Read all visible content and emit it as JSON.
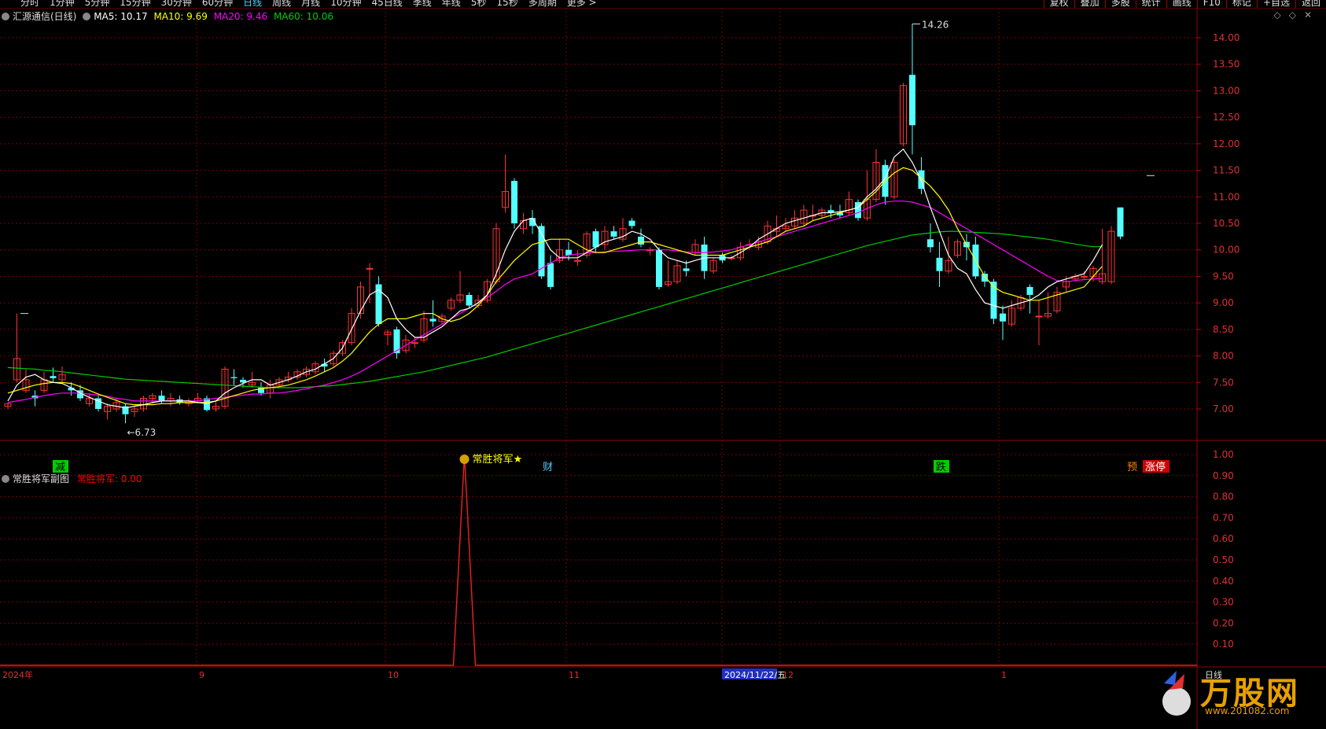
{
  "toolbar": {
    "periods": [
      "分时",
      "1分钟",
      "5分钟",
      "15分钟",
      "30分钟",
      "60分钟",
      "日线",
      "周线",
      "月线",
      "10分钟",
      "45日线",
      "季线",
      "年线",
      "5秒",
      "15秒",
      "多周期",
      "更多 >"
    ],
    "active_period": "日线",
    "tools": [
      "复权",
      "叠加",
      "多股",
      "统计",
      "画线",
      "F10",
      "标记",
      "+自选",
      "返回"
    ]
  },
  "main_legend": {
    "title": "汇源通信(日线)",
    "ma5": "MA5: 10.17",
    "ma10": "MA10: 9.69",
    "ma20": "MA20: 9.46",
    "ma60": "MA60: 10.06",
    "colors": {
      "ma5": "#ffffff",
      "ma10": "#ffff00",
      "ma20": "#ff00ff",
      "ma60": "#00cc00"
    }
  },
  "sub_legend": {
    "title": "常胜将军副图",
    "value": "常胜将军: 0.00",
    "signal_label": "常胜将军★"
  },
  "chart_data": {
    "type": "candlestick",
    "price_axis": [
      "14.00",
      "13.50",
      "13.00",
      "12.50",
      "12.00",
      "11.50",
      "11.00",
      "10.50",
      "10.00",
      "9.50",
      "9.00",
      "8.50",
      "8.00",
      "7.50",
      "7.00"
    ],
    "sub_axis": [
      "1.00",
      "0.90",
      "0.80",
      "0.70",
      "0.60",
      "0.50",
      "0.40",
      "0.30",
      "0.20",
      "0.10"
    ],
    "x_labels": [
      "2024年",
      "9",
      "10",
      "11",
      "2024/11/22/五",
      "12",
      "1"
    ],
    "high_label": "14.26",
    "low_label": "6.73",
    "event_markers": [
      "减",
      "财",
      "跌",
      "预",
      "涨停"
    ],
    "period_label": "日线",
    "candles": [
      [
        7.05,
        7.1,
        7.0,
        7.12
      ],
      [
        7.55,
        7.95,
        7.5,
        8.8
      ],
      [
        7.35,
        7.55,
        7.3,
        7.75
      ],
      [
        7.25,
        7.2,
        7.05,
        7.35
      ],
      [
        7.35,
        7.55,
        7.3,
        7.7
      ],
      [
        7.62,
        7.58,
        7.5,
        7.78
      ],
      [
        7.55,
        7.65,
        7.5,
        7.8
      ],
      [
        7.4,
        7.35,
        7.25,
        7.5
      ],
      [
        7.35,
        7.2,
        7.15,
        7.45
      ],
      [
        7.1,
        7.2,
        7.05,
        7.3
      ],
      [
        7.2,
        7.0,
        6.95,
        7.25
      ],
      [
        6.95,
        7.05,
        6.8,
        7.1
      ],
      [
        7.0,
        7.12,
        6.95,
        7.2
      ],
      [
        7.05,
        6.9,
        6.73,
        7.1
      ],
      [
        6.95,
        7.0,
        6.85,
        7.05
      ],
      [
        7.0,
        7.2,
        6.95,
        7.25
      ],
      [
        7.2,
        7.25,
        7.1,
        7.3
      ],
      [
        7.25,
        7.15,
        7.1,
        7.35
      ],
      [
        7.15,
        7.2,
        7.05,
        7.3
      ],
      [
        7.18,
        7.12,
        7.08,
        7.25
      ],
      [
        7.1,
        7.15,
        7.05,
        7.2
      ],
      [
        7.15,
        7.2,
        7.1,
        7.3
      ],
      [
        7.2,
        6.98,
        6.95,
        7.25
      ],
      [
        7.0,
        7.05,
        6.95,
        7.15
      ],
      [
        7.05,
        7.75,
        7.0,
        7.8
      ],
      [
        7.6,
        7.58,
        7.45,
        7.75
      ],
      [
        7.55,
        7.5,
        7.4,
        7.6
      ],
      [
        7.45,
        7.5,
        7.4,
        7.7
      ],
      [
        7.4,
        7.3,
        7.25,
        7.5
      ],
      [
        7.3,
        7.45,
        7.2,
        7.55
      ],
      [
        7.45,
        7.55,
        7.4,
        7.6
      ],
      [
        7.55,
        7.6,
        7.5,
        7.7
      ],
      [
        7.6,
        7.7,
        7.55,
        7.75
      ],
      [
        7.65,
        7.75,
        7.6,
        7.8
      ],
      [
        7.7,
        7.85,
        7.65,
        7.9
      ],
      [
        7.85,
        7.8,
        7.7,
        7.95
      ],
      [
        7.85,
        8.05,
        7.8,
        8.1
      ],
      [
        8.05,
        8.25,
        8.0,
        8.3
      ],
      [
        8.25,
        8.8,
        8.2,
        8.9
      ],
      [
        8.8,
        9.3,
        8.7,
        9.4
      ],
      [
        9.65,
        9.65,
        9.0,
        9.75
      ],
      [
        9.35,
        8.6,
        8.55,
        9.5
      ],
      [
        8.4,
        8.45,
        8.2,
        8.5
      ],
      [
        8.5,
        8.05,
        7.95,
        8.55
      ],
      [
        8.1,
        8.3,
        8.05,
        8.4
      ],
      [
        8.25,
        8.25,
        8.15,
        8.35
      ],
      [
        8.3,
        8.7,
        8.25,
        8.85
      ],
      [
        8.7,
        8.65,
        8.55,
        9.05
      ],
      [
        8.65,
        8.75,
        8.6,
        8.8
      ],
      [
        8.9,
        9.05,
        8.85,
        9.1
      ],
      [
        9.05,
        9.15,
        9.0,
        9.6
      ],
      [
        9.15,
        8.95,
        8.9,
        9.2
      ],
      [
        8.95,
        9.05,
        8.9,
        9.15
      ],
      [
        9.05,
        9.4,
        9.0,
        9.45
      ],
      [
        9.4,
        10.4,
        9.35,
        10.5
      ],
      [
        10.8,
        11.1,
        10.7,
        11.8
      ],
      [
        11.3,
        10.5,
        10.4,
        11.35
      ],
      [
        10.4,
        10.55,
        10.3,
        10.7
      ],
      [
        10.6,
        10.45,
        10.3,
        10.75
      ],
      [
        10.45,
        9.5,
        9.45,
        10.5
      ],
      [
        9.75,
        9.3,
        9.25,
        9.9
      ],
      [
        9.8,
        10.0,
        9.75,
        10.2
      ],
      [
        10.0,
        9.9,
        9.8,
        10.15
      ],
      [
        9.8,
        9.8,
        9.7,
        10.0
      ],
      [
        9.9,
        10.3,
        9.85,
        10.35
      ],
      [
        10.35,
        10.05,
        9.95,
        10.4
      ],
      [
        10.1,
        10.35,
        10.0,
        10.45
      ],
      [
        10.35,
        10.25,
        10.2,
        10.45
      ],
      [
        10.2,
        10.4,
        10.15,
        10.6
      ],
      [
        10.55,
        10.45,
        10.4,
        10.6
      ],
      [
        10.25,
        10.1,
        10.05,
        10.4
      ],
      [
        10.0,
        10.0,
        9.9,
        10.05
      ],
      [
        10.0,
        9.3,
        9.25,
        10.05
      ],
      [
        9.35,
        9.4,
        9.3,
        9.8
      ],
      [
        9.4,
        9.7,
        9.35,
        9.8
      ],
      [
        9.65,
        9.6,
        9.5,
        9.8
      ],
      [
        9.95,
        10.1,
        9.9,
        10.2
      ],
      [
        10.1,
        9.6,
        9.45,
        10.25
      ],
      [
        9.6,
        9.8,
        9.55,
        9.85
      ],
      [
        9.9,
        9.8,
        9.75,
        9.95
      ],
      [
        9.85,
        9.85,
        9.8,
        9.9
      ],
      [
        9.85,
        10.05,
        9.8,
        10.15
      ],
      [
        10.1,
        10.1,
        10.0,
        10.2
      ],
      [
        10.05,
        10.15,
        10.0,
        10.25
      ],
      [
        10.15,
        10.45,
        10.1,
        10.55
      ],
      [
        10.35,
        10.4,
        10.25,
        10.65
      ],
      [
        10.4,
        10.45,
        10.35,
        10.6
      ],
      [
        10.45,
        10.6,
        10.4,
        10.75
      ],
      [
        10.5,
        10.75,
        10.45,
        10.85
      ],
      [
        10.65,
        10.65,
        10.55,
        10.85
      ],
      [
        10.65,
        10.75,
        10.6,
        10.8
      ],
      [
        10.75,
        10.7,
        10.6,
        10.85
      ],
      [
        10.7,
        10.65,
        10.6,
        10.85
      ],
      [
        10.7,
        10.95,
        10.65,
        11.1
      ],
      [
        10.9,
        10.6,
        10.55,
        10.95
      ],
      [
        10.6,
        10.95,
        10.55,
        11.5
      ],
      [
        10.95,
        11.65,
        10.9,
        11.9
      ],
      [
        11.6,
        11.0,
        10.85,
        11.7
      ],
      [
        11.0,
        11.65,
        10.95,
        11.7
      ],
      [
        12.0,
        13.1,
        11.95,
        13.15
      ],
      [
        13.3,
        12.35,
        11.8,
        14.26
      ],
      [
        11.5,
        11.15,
        11.05,
        11.75
      ],
      [
        10.2,
        10.05,
        9.95,
        10.5
      ],
      [
        9.85,
        9.6,
        9.3,
        10.15
      ],
      [
        9.6,
        9.8,
        9.55,
        10.25
      ],
      [
        9.9,
        10.15,
        9.85,
        10.2
      ],
      [
        10.15,
        10.05,
        9.8,
        10.3
      ],
      [
        10.1,
        9.5,
        9.45,
        10.25
      ],
      [
        9.55,
        9.4,
        9.3,
        9.6
      ],
      [
        9.4,
        8.7,
        8.6,
        9.45
      ],
      [
        8.8,
        8.65,
        8.3,
        8.95
      ],
      [
        8.6,
        8.9,
        8.55,
        9.05
      ],
      [
        8.9,
        9.1,
        8.85,
        9.15
      ],
      [
        9.3,
        9.15,
        8.8,
        9.35
      ],
      [
        8.75,
        8.75,
        8.2,
        9.05
      ],
      [
        8.75,
        8.8,
        8.7,
        9.2
      ],
      [
        8.85,
        9.2,
        8.8,
        9.3
      ],
      [
        9.3,
        9.4,
        9.2,
        9.5
      ],
      [
        9.45,
        9.5,
        9.4,
        9.55
      ],
      [
        9.5,
        9.5,
        9.45,
        9.6
      ],
      [
        9.5,
        9.65,
        9.4,
        9.7
      ],
      [
        9.4,
        9.55,
        9.35,
        10.4
      ],
      [
        9.4,
        10.35,
        9.35,
        10.45
      ],
      [
        10.8,
        10.25,
        10.2,
        10.8
      ]
    ],
    "ma5": [
      7.15,
      7.45,
      7.6,
      7.65,
      7.55,
      7.5,
      7.48,
      7.4,
      7.3,
      7.22,
      7.15,
      7.08,
      7.05,
      7.02,
      7.05,
      7.08,
      7.12,
      7.15,
      7.15,
      7.15,
      7.15,
      7.12,
      7.1,
      7.15,
      7.3,
      7.4,
      7.48,
      7.55,
      7.55,
      7.45,
      7.5,
      7.55,
      7.62,
      7.7,
      7.75,
      7.85,
      7.95,
      8.15,
      8.5,
      8.85,
      9.15,
      9.25,
      9.1,
      8.7,
      8.5,
      8.35,
      8.35,
      8.45,
      8.55,
      8.7,
      8.85,
      8.9,
      9.0,
      9.15,
      9.55,
      10.0,
      10.35,
      10.55,
      10.6,
      10.3,
      10.0,
      9.85,
      9.85,
      9.85,
      9.95,
      10.05,
      10.15,
      10.2,
      10.25,
      10.35,
      10.3,
      10.2,
      10.0,
      9.85,
      9.8,
      9.75,
      9.8,
      9.85,
      9.85,
      9.85,
      9.85,
      9.95,
      10.05,
      10.2,
      10.3,
      10.4,
      10.5,
      10.55,
      10.6,
      10.65,
      10.7,
      10.7,
      10.72,
      10.75,
      10.8,
      11.0,
      11.15,
      11.35,
      11.75,
      11.9,
      11.65,
      11.3,
      10.8,
      10.35,
      9.9,
      9.65,
      9.55,
      9.25,
      9.0,
      8.95,
      8.9,
      8.95,
      9.0,
      9.05,
      9.15,
      9.3,
      9.4,
      9.45,
      9.5,
      9.55,
      9.8,
      10.1
    ],
    "ma10": [
      7.3,
      7.35,
      7.4,
      7.45,
      7.48,
      7.5,
      7.5,
      7.48,
      7.42,
      7.35,
      7.28,
      7.22,
      7.16,
      7.1,
      7.08,
      7.08,
      7.08,
      7.1,
      7.1,
      7.12,
      7.12,
      7.12,
      7.12,
      7.15,
      7.2,
      7.25,
      7.3,
      7.35,
      7.38,
      7.4,
      7.42,
      7.45,
      7.5,
      7.55,
      7.62,
      7.7,
      7.78,
      7.9,
      8.05,
      8.25,
      8.45,
      8.6,
      8.7,
      8.7,
      8.7,
      8.75,
      8.8,
      8.8,
      8.7,
      8.65,
      8.7,
      8.8,
      8.95,
      9.15,
      9.4,
      9.6,
      9.8,
      9.95,
      10.1,
      10.15,
      10.2,
      10.2,
      10.2,
      10.1,
      10.0,
      9.95,
      9.95,
      10.0,
      10.05,
      10.1,
      10.15,
      10.15,
      10.1,
      10.05,
      10.0,
      9.95,
      9.9,
      9.9,
      9.9,
      9.9,
      9.95,
      10.0,
      10.05,
      10.1,
      10.15,
      10.25,
      10.35,
      10.4,
      10.45,
      10.55,
      10.6,
      10.65,
      10.7,
      10.75,
      10.8,
      10.95,
      11.1,
      11.3,
      11.45,
      11.55,
      11.5,
      11.35,
      11.2,
      11.0,
      10.75,
      10.4,
      10.1,
      9.8,
      9.5,
      9.3,
      9.2,
      9.15,
      9.1,
      9.05,
      9.05,
      9.1,
      9.15,
      9.2,
      9.25,
      9.3,
      9.5,
      9.69
    ],
    "ma20": [
      7.12,
      7.15,
      7.18,
      7.22,
      7.25,
      7.28,
      7.3,
      7.3,
      7.3,
      7.28,
      7.26,
      7.24,
      7.2,
      7.18,
      7.15,
      7.15,
      7.15,
      7.15,
      7.15,
      7.15,
      7.15,
      7.15,
      7.18,
      7.2,
      7.22,
      7.24,
      7.26,
      7.28,
      7.28,
      7.3,
      7.3,
      7.32,
      7.35,
      7.38,
      7.42,
      7.45,
      7.5,
      7.55,
      7.62,
      7.7,
      7.8,
      7.9,
      8.0,
      8.1,
      8.2,
      8.3,
      8.4,
      8.5,
      8.6,
      8.7,
      8.8,
      8.9,
      9.0,
      9.1,
      9.22,
      9.35,
      9.45,
      9.5,
      9.55,
      9.65,
      9.75,
      9.85,
      9.9,
      9.92,
      9.94,
      9.95,
      9.96,
      9.97,
      9.98,
      9.99,
      10.0,
      10.0,
      10.0,
      10.0,
      9.98,
      9.96,
      9.95,
      9.95,
      9.96,
      9.98,
      10.0,
      10.05,
      10.1,
      10.15,
      10.2,
      10.25,
      10.3,
      10.35,
      10.4,
      10.45,
      10.5,
      10.55,
      10.6,
      10.65,
      10.7,
      10.78,
      10.85,
      10.9,
      10.92,
      10.92,
      10.9,
      10.85,
      10.8,
      10.7,
      10.6,
      10.5,
      10.4,
      10.3,
      10.2,
      10.1,
      10.0,
      9.9,
      9.8,
      9.7,
      9.6,
      9.5,
      9.42,
      9.4,
      9.42,
      9.44,
      9.45,
      9.46
    ],
    "ma60": [
      7.78,
      7.77,
      7.76,
      7.75,
      7.73,
      7.72,
      7.7,
      7.68,
      7.66,
      7.64,
      7.62,
      7.6,
      7.58,
      7.56,
      7.55,
      7.54,
      7.53,
      7.52,
      7.51,
      7.5,
      7.49,
      7.48,
      7.47,
      7.46,
      7.45,
      7.44,
      7.43,
      7.42,
      7.41,
      7.4,
      7.4,
      7.4,
      7.4,
      7.41,
      7.42,
      7.43,
      7.44,
      7.46,
      7.48,
      7.5,
      7.52,
      7.55,
      7.58,
      7.61,
      7.64,
      7.67,
      7.7,
      7.74,
      7.78,
      7.82,
      7.86,
      7.9,
      7.94,
      7.98,
      8.03,
      8.08,
      8.13,
      8.18,
      8.23,
      8.28,
      8.33,
      8.38,
      8.43,
      8.48,
      8.53,
      8.58,
      8.63,
      8.68,
      8.73,
      8.78,
      8.83,
      8.88,
      8.93,
      8.98,
      9.03,
      9.08,
      9.13,
      9.18,
      9.23,
      9.28,
      9.33,
      9.38,
      9.43,
      9.48,
      9.53,
      9.58,
      9.63,
      9.68,
      9.73,
      9.78,
      9.83,
      9.88,
      9.93,
      9.98,
      10.03,
      10.08,
      10.12,
      10.16,
      10.2,
      10.24,
      10.28,
      10.3,
      10.32,
      10.34,
      10.35,
      10.35,
      10.34,
      10.33,
      10.32,
      10.31,
      10.3,
      10.28,
      10.26,
      10.24,
      10.22,
      10.2,
      10.17,
      10.14,
      10.11,
      10.08,
      10.06,
      10.06
    ],
    "signal_index": 47
  }
}
